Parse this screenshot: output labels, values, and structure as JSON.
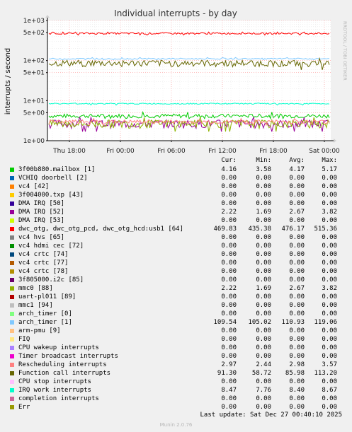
{
  "chart_data": {
    "type": "line",
    "title": "Individual interrupts - by day",
    "ylabel": "interrupts / second",
    "side_label": "RRDTOOL / TOBI OETIKER",
    "yscale": "log",
    "ylim": [
      1,
      1000
    ],
    "y_ticks": [
      {
        "value": 1,
        "label": "1e+00"
      },
      {
        "value": 5,
        "label": "5e+00"
      },
      {
        "value": 10,
        "label": "1e+01"
      },
      {
        "value": 50,
        "label": "5e+01"
      },
      {
        "value": 100,
        "label": "1e+02"
      },
      {
        "value": 500,
        "label": "5e+02"
      },
      {
        "value": 1000,
        "label": "1e+03"
      }
    ],
    "x_ticks": [
      "Thu 18:00",
      "Fri 00:00",
      "Fri 06:00",
      "Fri 12:00",
      "Fri 18:00",
      "Sat 00:00"
    ],
    "grid": true,
    "columns": [
      "Cur:",
      "Min:",
      "Avg:",
      "Max:"
    ],
    "series": [
      {
        "name": "3f00b880.mailbox [1]",
        "color": "#00cc00",
        "cur": "4.16",
        "min": "3.58",
        "avg": "4.17",
        "max": "5.17"
      },
      {
        "name": "VCHIQ doorbell [2]",
        "color": "#0066b3",
        "cur": "0.00",
        "min": "0.00",
        "avg": "0.00",
        "max": "0.00"
      },
      {
        "name": "vc4 [42]",
        "color": "#ff8000",
        "cur": "0.00",
        "min": "0.00",
        "avg": "0.00",
        "max": "0.00"
      },
      {
        "name": "3f004000.txp [43]",
        "color": "#ffcc00",
        "cur": "0.00",
        "min": "0.00",
        "avg": "0.00",
        "max": "0.00"
      },
      {
        "name": "DMA IRQ [50]",
        "color": "#330099",
        "cur": "0.00",
        "min": "0.00",
        "avg": "0.00",
        "max": "0.00"
      },
      {
        "name": "DMA IRQ [52]",
        "color": "#990099",
        "cur": "2.22",
        "min": "1.69",
        "avg": "2.67",
        "max": "3.82"
      },
      {
        "name": "DMA IRQ [53]",
        "color": "#ccff00",
        "cur": "0.00",
        "min": "0.00",
        "avg": "0.00",
        "max": "0.00"
      },
      {
        "name": "dwc_otg, dwc_otg_pcd, dwc_otg_hcd:usb1 [64]",
        "color": "#ff0000",
        "cur": "469.83",
        "min": "435.38",
        "avg": "476.17",
        "max": "515.36"
      },
      {
        "name": "vc4 hvs [65]",
        "color": "#808080",
        "cur": "0.00",
        "min": "0.00",
        "avg": "0.00",
        "max": "0.00"
      },
      {
        "name": "vc4 hdmi cec [72]",
        "color": "#008f00",
        "cur": "0.00",
        "min": "0.00",
        "avg": "0.00",
        "max": "0.00"
      },
      {
        "name": "vc4 crtc [74]",
        "color": "#00487d",
        "cur": "0.00",
        "min": "0.00",
        "avg": "0.00",
        "max": "0.00"
      },
      {
        "name": "vc4 crtc [77]",
        "color": "#b35a00",
        "cur": "0.00",
        "min": "0.00",
        "avg": "0.00",
        "max": "0.00"
      },
      {
        "name": "vc4 crtc [78]",
        "color": "#b38f00",
        "cur": "0.00",
        "min": "0.00",
        "avg": "0.00",
        "max": "0.00"
      },
      {
        "name": "3f805000.i2c [85]",
        "color": "#6b006b",
        "cur": "0.00",
        "min": "0.00",
        "avg": "0.00",
        "max": "0.00"
      },
      {
        "name": "mmc0 [88]",
        "color": "#8fb300",
        "cur": "2.22",
        "min": "1.69",
        "avg": "2.67",
        "max": "3.82"
      },
      {
        "name": "uart-pl011 [89]",
        "color": "#b30000",
        "cur": "0.00",
        "min": "0.00",
        "avg": "0.00",
        "max": "0.00"
      },
      {
        "name": "mmc1 [94]",
        "color": "#bebebe",
        "cur": "0.00",
        "min": "0.00",
        "avg": "0.00",
        "max": "0.00"
      },
      {
        "name": "arch_timer [0]",
        "color": "#80ff80",
        "cur": "0.00",
        "min": "0.00",
        "avg": "0.00",
        "max": "0.00"
      },
      {
        "name": "arch_timer [1]",
        "color": "#80c9ff",
        "cur": "109.54",
        "min": "105.02",
        "avg": "110.93",
        "max": "119.06"
      },
      {
        "name": "arm-pmu [9]",
        "color": "#ffc080",
        "cur": "0.00",
        "min": "0.00",
        "avg": "0.00",
        "max": "0.00"
      },
      {
        "name": "FIQ",
        "color": "#ffe680",
        "cur": "0.00",
        "min": "0.00",
        "avg": "0.00",
        "max": "0.00"
      },
      {
        "name": "CPU wakeup interrupts",
        "color": "#aa80ff",
        "cur": "0.00",
        "min": "0.00",
        "avg": "0.00",
        "max": "0.00"
      },
      {
        "name": "Timer broadcast interrupts",
        "color": "#ee00cc",
        "cur": "0.00",
        "min": "0.00",
        "avg": "0.00",
        "max": "0.00"
      },
      {
        "name": "Rescheduling interrupts",
        "color": "#ff8080",
        "cur": "2.97",
        "min": "2.44",
        "avg": "2.98",
        "max": "3.57"
      },
      {
        "name": "Function call interrupts",
        "color": "#666600",
        "cur": "91.30",
        "min": "58.72",
        "avg": "85.98",
        "max": "113.20"
      },
      {
        "name": "CPU stop interrupts",
        "color": "#ffbfff",
        "cur": "0.00",
        "min": "0.00",
        "avg": "0.00",
        "max": "0.00"
      },
      {
        "name": "IRQ work interrupts",
        "color": "#00ffcc",
        "cur": "8.47",
        "min": "7.76",
        "avg": "8.40",
        "max": "8.67"
      },
      {
        "name": "completion interrupts",
        "color": "#cc6699",
        "cur": "0.00",
        "min": "0.00",
        "avg": "0.00",
        "max": "0.00"
      },
      {
        "name": "Err",
        "color": "#999900",
        "cur": "0.00",
        "min": "0.00",
        "avg": "0.00",
        "max": "0.00"
      }
    ]
  },
  "footer": {
    "last_update": "Last update: Sat Dec 27 00:40:10 2025",
    "munin": "Munin 2.0.76"
  }
}
